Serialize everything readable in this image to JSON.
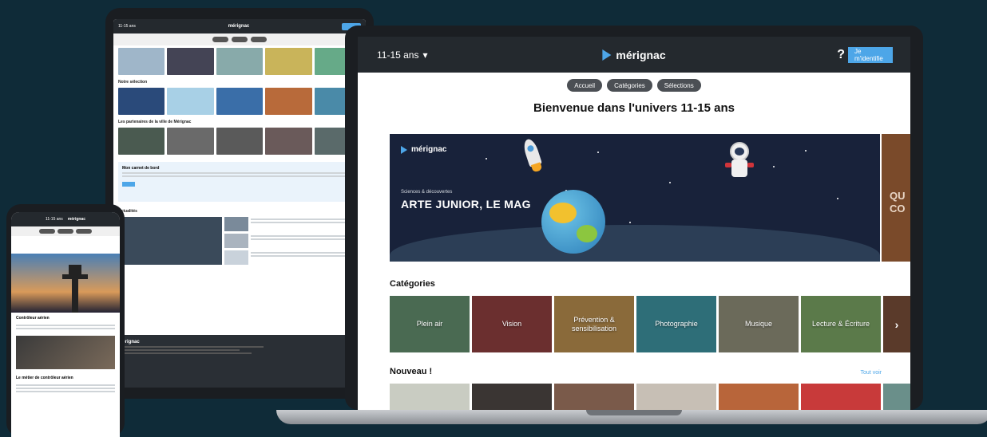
{
  "laptop": {
    "header": {
      "age_selector": "11-15 ans",
      "brand": "mérignac",
      "help": "?",
      "login": "Je m'identifie"
    },
    "nav": [
      "Accueil",
      "Catégories",
      "Sélections"
    ],
    "page_title": "Bienvenue dans l'univers 11-15 ans",
    "hero": {
      "brand": "mérignac",
      "kicker": "Sciences & découvertes",
      "title": "ARTE JUNIOR, LE MAG",
      "next_peek": [
        "QU",
        "CO"
      ]
    },
    "categories_title": "Catégories",
    "categories": [
      {
        "label": "Plein air",
        "color": "#4a6a52"
      },
      {
        "label": "Vision",
        "color": "#6b2f2f"
      },
      {
        "label": "Prévention & sensibilisation",
        "color": "#8a6a3a"
      },
      {
        "label": "Photographie",
        "color": "#2e6e78"
      },
      {
        "label": "Musique",
        "color": "#6b6a5a"
      },
      {
        "label": "Lecture & Écriture",
        "color": "#5b7a4a"
      }
    ],
    "categories_more": "›",
    "new_title": "Nouveau !",
    "see_all": "Tout voir",
    "new_tiles": [
      "#c9ccc2",
      "#3a3533",
      "#7a5a4a",
      "#c7bfb5",
      "#b8653a",
      "#c83a3a",
      "#6a8f8a"
    ]
  },
  "tablet": {
    "header": {
      "age_selector": "11-15 ans",
      "brand": "mérignac"
    },
    "sections": [
      "Notre sélection",
      "Les partenaires de la ville de Mérignac",
      "Mon carnet de bord",
      "Actualités"
    ],
    "footer_brand": "mérignac"
  },
  "phone": {
    "header": {
      "age_selector": "11-15 ans",
      "brand": "mérignac"
    },
    "section_1": "Contrôleur aérien",
    "section_2": "Le métier de contrôleur aérien"
  }
}
